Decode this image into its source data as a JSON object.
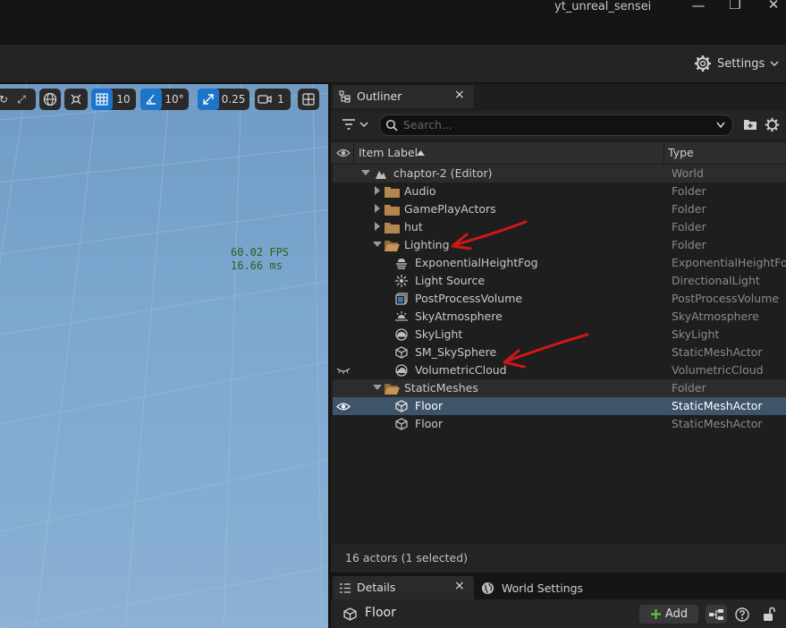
{
  "window": {
    "title": "yt_unreal_sensei"
  },
  "toolbar": {
    "settings_label": "Settings"
  },
  "viewport": {
    "grid_snap": "10",
    "rotation_snap": "10°",
    "scale_snap": "0.25",
    "camera_speed": "1",
    "fps": "60.02 FPS",
    "frame_time": "16.66 ms"
  },
  "outliner": {
    "tab_label": "Outliner",
    "close_glyph": "×",
    "search_placeholder": "Search...",
    "col_label": "Item Label",
    "col_type": "Type",
    "rows": [
      {
        "label": "chaptor-2 (Editor)",
        "type": "World"
      },
      {
        "label": "Audio",
        "type": "Folder"
      },
      {
        "label": "GamePlayActors",
        "type": "Folder"
      },
      {
        "label": "hut",
        "type": "Folder"
      },
      {
        "label": "Lighting",
        "type": "Folder"
      },
      {
        "label": "ExponentialHeightFog",
        "type": "ExponentialHeightFog"
      },
      {
        "label": "Light Source",
        "type": "DirectionalLight"
      },
      {
        "label": "PostProcessVolume",
        "type": "PostProcessVolume"
      },
      {
        "label": "SkyAtmosphere",
        "type": "SkyAtmosphere"
      },
      {
        "label": "SkyLight",
        "type": "SkyLight"
      },
      {
        "label": "SM_SkySphere",
        "type": "StaticMeshActor"
      },
      {
        "label": "VolumetricCloud",
        "type": "VolumetricCloud"
      },
      {
        "label": "StaticMeshes",
        "type": "Folder"
      },
      {
        "label": "Floor",
        "type": "StaticMeshActor"
      },
      {
        "label": "Floor",
        "type": "StaticMeshActor"
      }
    ],
    "status": "16 actors (1 selected)"
  },
  "details": {
    "tab_label": "Details",
    "world_settings_label": "World Settings",
    "selected_name": "Floor",
    "add_label": "Add"
  },
  "colors": {
    "accent": "#1d74c9",
    "selection": "#3e5468",
    "annotation": "#d0161b"
  }
}
